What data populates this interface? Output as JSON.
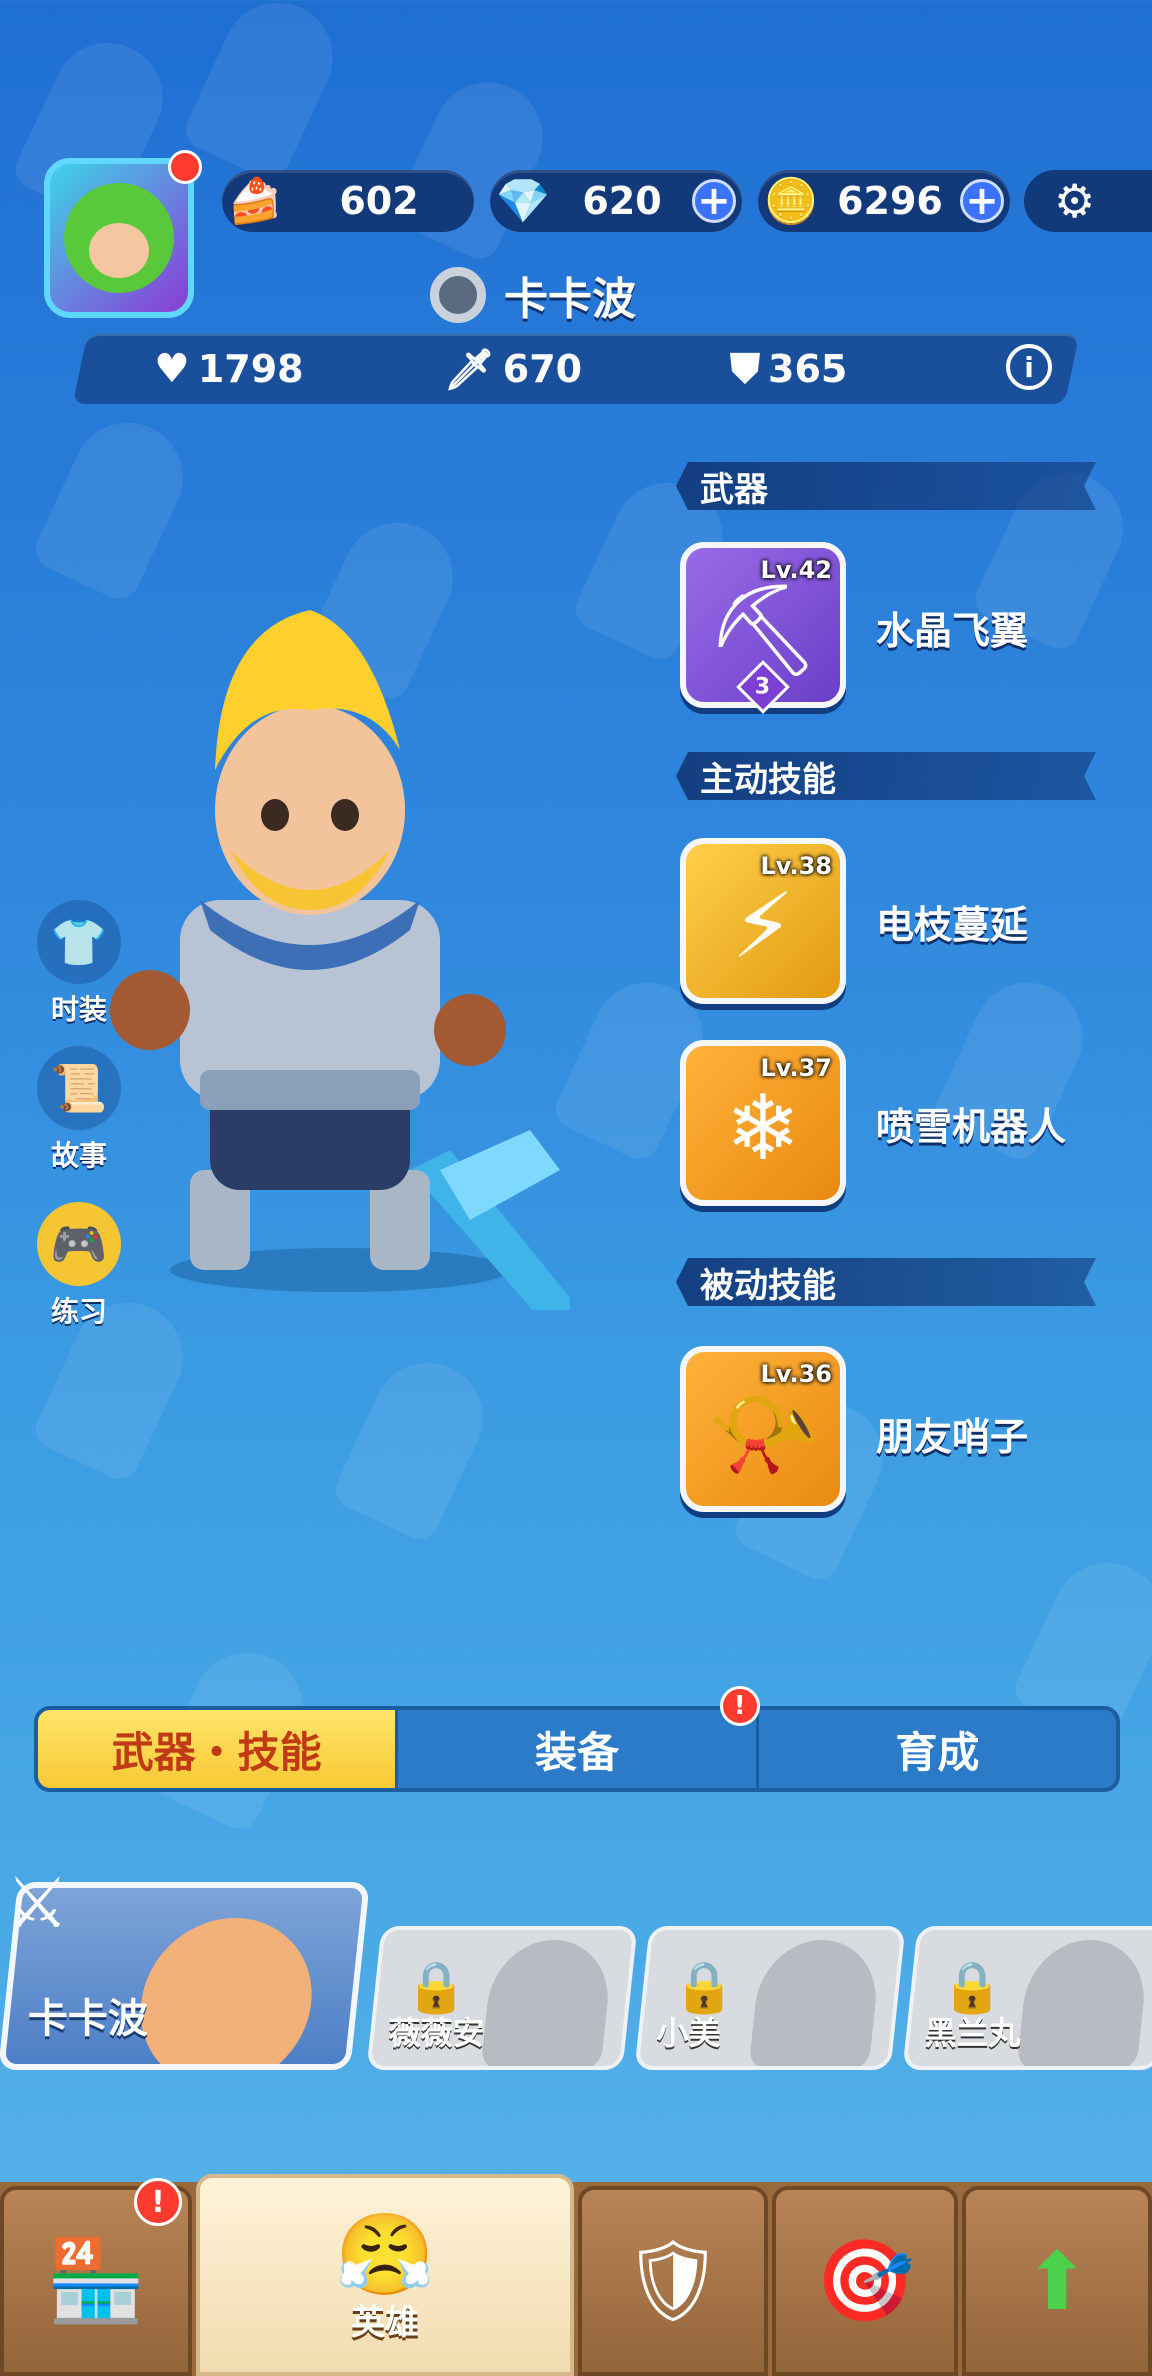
{
  "resources": {
    "cake": "602",
    "gems": "620",
    "coins": "6296"
  },
  "player": {
    "name": "卡卡波"
  },
  "stats": {
    "hp": "1798",
    "attack": "670",
    "defense": "365"
  },
  "sections": {
    "weapon": "武器",
    "active_skill": "主动技能",
    "passive_skill": "被动技能"
  },
  "skills": {
    "weapon": {
      "level": "Lv.42",
      "name": "水晶飞翼",
      "star": "3"
    },
    "active1": {
      "level": "Lv.38",
      "name": "电枝蔓延"
    },
    "active2": {
      "level": "Lv.37",
      "name": "喷雪机器人"
    },
    "passive1": {
      "level": "Lv.36",
      "name": "朋友哨子"
    }
  },
  "side_buttons": {
    "costume": "时装",
    "story": "故事",
    "practice": "练习"
  },
  "tabs": {
    "weapon_skill": "武器・技能",
    "equipment": "装备",
    "training": "育成",
    "alert": "!"
  },
  "heroes": [
    {
      "name": "卡卡波"
    },
    {
      "name": "薇薇安"
    },
    {
      "name": "小美"
    },
    {
      "name": "黑兰丸"
    }
  ],
  "nav": {
    "hero": "英雄",
    "alert": "!"
  },
  "colors": {
    "accent_yellow": "#f7c934",
    "dark_blue": "#123a7a",
    "alert_red": "#ff3b2f"
  }
}
